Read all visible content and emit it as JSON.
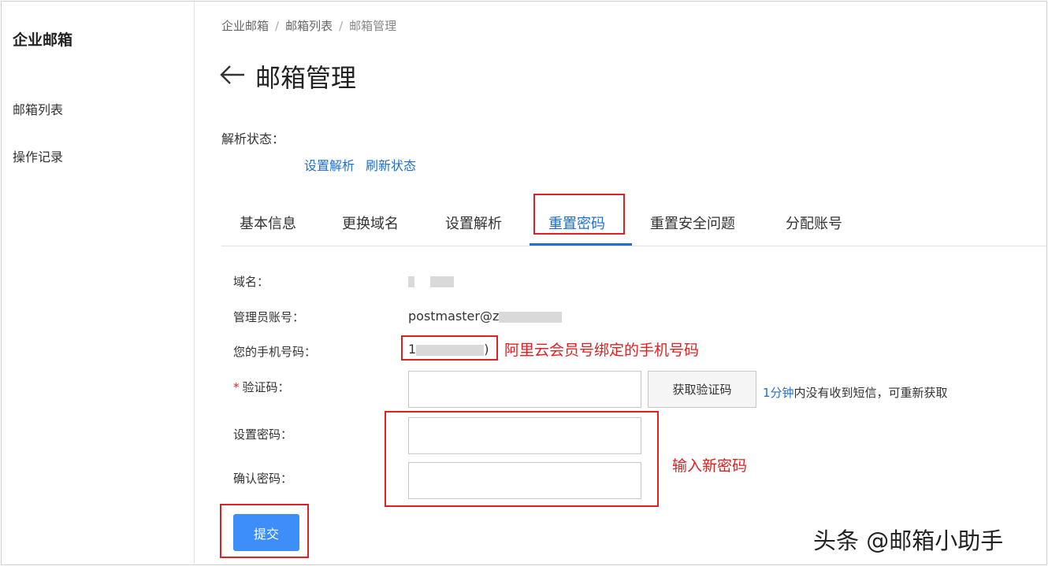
{
  "sidebar": {
    "title": "企业邮箱",
    "items": [
      {
        "label": "邮箱列表"
      },
      {
        "label": "操作记录"
      }
    ]
  },
  "breadcrumb": {
    "items": [
      "企业邮箱",
      "邮箱列表",
      "邮箱管理"
    ],
    "separator": "/"
  },
  "page": {
    "back_icon": "arrow-left-icon",
    "title": "邮箱管理"
  },
  "dns": {
    "label": "解析状态：",
    "links": [
      "设置解析",
      "刷新状态"
    ]
  },
  "tabs": [
    {
      "label": "基本信息"
    },
    {
      "label": "更换域名"
    },
    {
      "label": "设置解析"
    },
    {
      "label": "重置密码",
      "active": true
    },
    {
      "label": "重置安全问题"
    },
    {
      "label": "分配账号"
    }
  ],
  "form": {
    "domain_label": "域名：",
    "admin_label": "管理员账号：",
    "admin_value_prefix": "postmaster@z",
    "phone_label": "您的手机号码：",
    "phone_value_start": "1",
    "phone_value_end": ")",
    "required_mark": "*",
    "code_label": "验证码：",
    "get_code_button": "获取验证码",
    "hint_time": "1分钟",
    "hint_text": "内没有收到短信，可重新获取",
    "new_password_label": "设置密码：",
    "confirm_password_label": "确认密码：",
    "submit_button": "提交"
  },
  "annotations": {
    "phone_note": "阿里云会员号绑定的手机号码",
    "password_note": "输入新密码"
  },
  "watermark": "头条 @邮箱小助手",
  "colors": {
    "accent": "#1f6fd1",
    "annotation_red": "#e02020",
    "submit_blue": "#3d8ef8"
  }
}
